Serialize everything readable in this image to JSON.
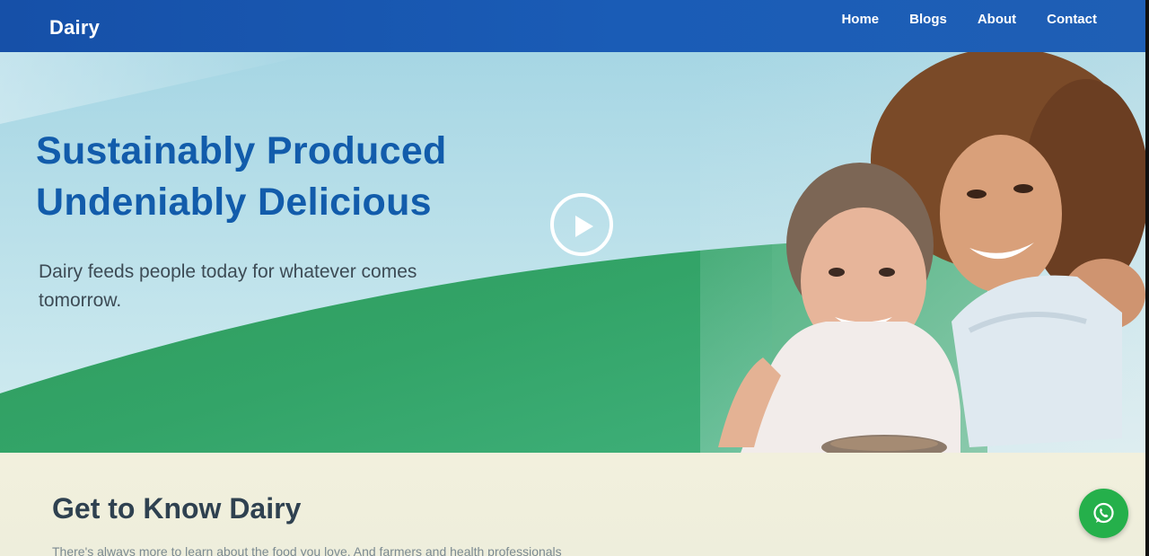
{
  "nav": {
    "brand": "Dairy",
    "links": [
      {
        "label": "Home"
      },
      {
        "label": "Blogs"
      },
      {
        "label": "About"
      },
      {
        "label": "Contact"
      }
    ]
  },
  "hero": {
    "headline_line1": "Sustainably Produced",
    "headline_line2": "Undeniably Delicious",
    "subtext": "Dairy feeds people today for whatever comes tomorrow.",
    "play_icon": "play-icon",
    "photo_alt": "mother and daughter pouring milk into cereal bowl"
  },
  "info": {
    "title": "Get to Know Dairy",
    "text": "There's always more to learn about the food you love. And farmers and health professionals"
  },
  "floating": {
    "whatsapp_icon": "whatsapp-icon"
  },
  "colors": {
    "navbar": "#1a5cb6",
    "headline": "#125cab",
    "hill_green": "#2e9a5c",
    "whatsapp_green": "#25b04b"
  }
}
